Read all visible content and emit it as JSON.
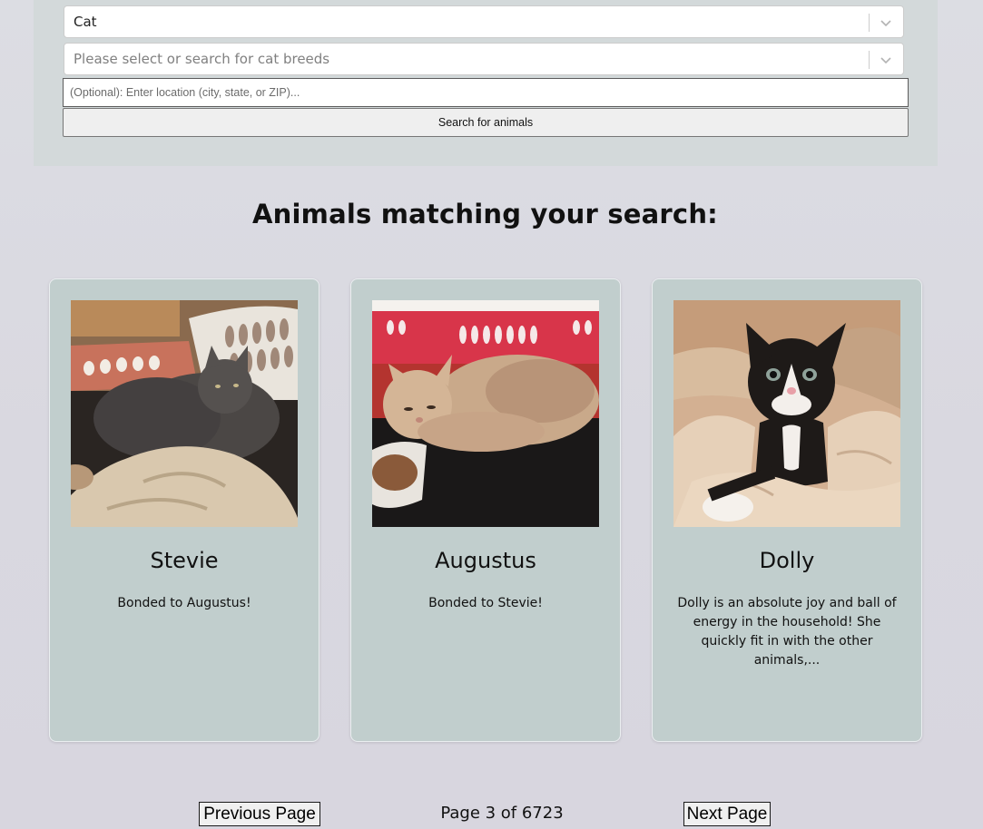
{
  "search": {
    "species_value": "Cat",
    "breed_placeholder": "Please select or search for cat breeds",
    "location_placeholder": "(Optional): Enter location (city, state, or ZIP)...",
    "location_value": "",
    "button_label": "Search for animals"
  },
  "results": {
    "heading": "Animals matching your search:",
    "animals": [
      {
        "name": "Stevie",
        "description": "Bonded to Augustus!"
      },
      {
        "name": "Augustus",
        "description": "Bonded to Stevie!"
      },
      {
        "name": "Dolly",
        "description": "Dolly is an absolute joy and ball of energy in the household! She quickly fit in with the other animals,..."
      }
    ]
  },
  "pagination": {
    "prev_label": "Previous Page",
    "indicator": "Page 3 of 6723",
    "next_label": "Next Page"
  },
  "icons": {
    "dropdown": "chevron-down-icon"
  }
}
